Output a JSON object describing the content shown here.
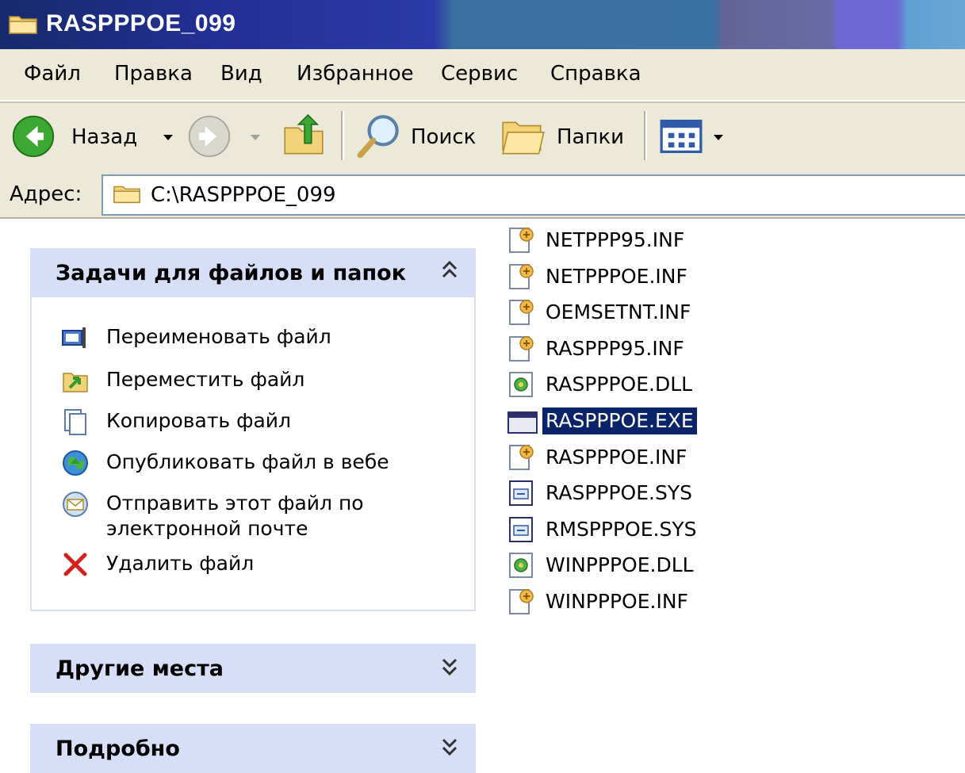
{
  "window": {
    "title": "RASPPPOE_099"
  },
  "menu": [
    "Файл",
    "Правка",
    "Вид",
    "Избранное",
    "Сервис",
    "Справка"
  ],
  "toolbar": {
    "back_label": "Назад",
    "search_label": "Поиск",
    "folders_label": "Папки"
  },
  "address": {
    "label": "Адрес:",
    "value": "C:\\RASPPPOE_099"
  },
  "tasks_panel": {
    "title": "Задачи для файлов и папок",
    "items": [
      {
        "label": "Переименовать файл",
        "icon": "rename-icon"
      },
      {
        "label": "Переместить файл",
        "icon": "move-icon"
      },
      {
        "label": "Копировать файл",
        "icon": "copy-icon"
      },
      {
        "label": "Опубликовать файл в вебе",
        "icon": "web-publish-icon"
      },
      {
        "label": "Отправить этот файл по электронной почте",
        "icon": "email-icon"
      },
      {
        "label": "Удалить файл",
        "icon": "delete-icon"
      }
    ]
  },
  "other_places_panel": {
    "title": "Другие места"
  },
  "details_panel": {
    "title": "Подробно"
  },
  "files": [
    {
      "name": "NETPPP95.INF",
      "type": "inf"
    },
    {
      "name": "NETPPPOE.INF",
      "type": "inf"
    },
    {
      "name": "OEMSETNT.INF",
      "type": "inf"
    },
    {
      "name": "RASPPP95.INF",
      "type": "inf"
    },
    {
      "name": "RASPPPOE.DLL",
      "type": "dll"
    },
    {
      "name": "RASPPPOE.EXE",
      "type": "exe",
      "selected": true
    },
    {
      "name": "RASPPPOE.INF",
      "type": "inf"
    },
    {
      "name": "RASPPPOE.SYS",
      "type": "sys"
    },
    {
      "name": "RMSPPPOE.SYS",
      "type": "sys"
    },
    {
      "name": "WINPPPOE.DLL",
      "type": "dll"
    },
    {
      "name": "WINPPPOE.INF",
      "type": "inf"
    }
  ],
  "colors": {
    "selection": "#0a246a",
    "panel_header": "#d6dff7",
    "chrome": "#ece9d8"
  }
}
